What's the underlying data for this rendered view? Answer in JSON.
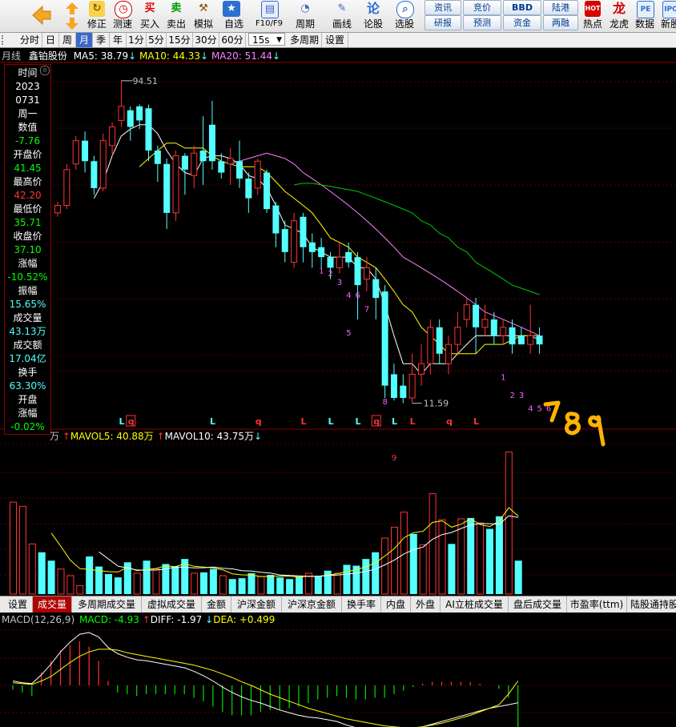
{
  "toolbar": {
    "buttons": [
      {
        "label": "",
        "icon": "arrow-left-icon"
      },
      {
        "label": "修正",
        "icon": "up-down-arrow-icon"
      },
      {
        "label": "测速",
        "icon": "speed-icon"
      },
      {
        "label": "买入",
        "icon": "buy-icon",
        "glyph": "买"
      },
      {
        "label": "卖出",
        "icon": "sell-icon",
        "glyph": "卖"
      },
      {
        "label": "模拟",
        "icon": "hammer-icon"
      },
      {
        "label": "自选",
        "icon": "star-icon"
      },
      {
        "label": "F10/F9",
        "icon": "f10-icon"
      },
      {
        "label": "周期",
        "icon": "clock-icon"
      },
      {
        "label": "画线",
        "icon": "pencil-icon"
      },
      {
        "label": "论股",
        "icon": "discuss-icon",
        "glyph": "论"
      },
      {
        "label": "选股",
        "icon": "stock-pick-icon"
      }
    ],
    "small_buttons": [
      "资讯",
      "竞价",
      "BBD",
      "陆港",
      "研报",
      "预测",
      "资金",
      "两融"
    ],
    "right_buttons": [
      {
        "label": "热点",
        "icon": "hot-icon",
        "glyph": "HOT"
      },
      {
        "label": "龙虎",
        "icon": "dragon-icon"
      },
      {
        "label": "数据",
        "icon": "pe-icon",
        "glyph": "PE"
      },
      {
        "label": "新股",
        "icon": "new-stock-icon"
      }
    ]
  },
  "period_bar": {
    "items": [
      "分时",
      "日",
      "周",
      "月",
      "季",
      "年",
      "1分",
      "5分",
      "15分",
      "30分",
      "60分",
      "15s",
      "多周期",
      "设置"
    ],
    "active": "月"
  },
  "chart_header": {
    "period": "月线",
    "stock": "鑫铂股份",
    "ma5": "MA5: 38.79",
    "ma10": "MA10: 44.33",
    "ma20": "MA20: 51.44"
  },
  "info_panel": {
    "rows": [
      {
        "text": "时间",
        "color": "#ffffff"
      },
      {
        "text": "2023",
        "color": "#ffffff"
      },
      {
        "text": "0731",
        "color": "#ffffff"
      },
      {
        "text": "周一",
        "color": "#ffffff"
      },
      {
        "text": "数值",
        "color": "#ffffff"
      },
      {
        "text": "-7.76",
        "color": "#00ff00"
      },
      {
        "text": "开盘价",
        "color": "#ffffff"
      },
      {
        "text": "41.45",
        "color": "#00ff00"
      },
      {
        "text": "最高价",
        "color": "#ffffff"
      },
      {
        "text": "42.20",
        "color": "#ff3232"
      },
      {
        "text": "最低价",
        "color": "#ffffff"
      },
      {
        "text": "35.71",
        "color": "#00ff00"
      },
      {
        "text": "收盘价",
        "color": "#ffffff"
      },
      {
        "text": "37.10",
        "color": "#00ff00"
      },
      {
        "text": "涨幅",
        "color": "#ffffff"
      },
      {
        "text": "-10.52%",
        "color": "#00ff00"
      },
      {
        "text": "振幅",
        "color": "#ffffff"
      },
      {
        "text": "15.65%",
        "color": "#54ffff"
      },
      {
        "text": "成交量",
        "color": "#ffffff"
      },
      {
        "text": "43.13万",
        "color": "#54ffff"
      },
      {
        "text": "成交额",
        "color": "#ffffff"
      },
      {
        "text": "17.04亿",
        "color": "#54ffff"
      },
      {
        "text": "换手",
        "color": "#ffffff"
      },
      {
        "text": "63.30%",
        "color": "#54ffff"
      },
      {
        "text": "开盘",
        "color": "#ffffff"
      },
      {
        "text": "涨幅",
        "color": "#ffffff"
      },
      {
        "text": "-0.02%",
        "color": "#00ff00"
      }
    ]
  },
  "volume_header": {
    "unit": "万",
    "mavol5": "MAVOL5: 40.88万",
    "mavol10": "MAVOL10: 43.75万"
  },
  "bottom_tabs": {
    "items": [
      "设置",
      "成交量",
      "多周期成交量",
      "虚拟成交量",
      "金额",
      "沪深金额",
      "沪深京金额",
      "换手率",
      "内盘",
      "外盘",
      "AI立桩成交量",
      "盘后成交量",
      "市盈率(ttm)",
      "陆股通持股"
    ],
    "active": "成交量"
  },
  "macd_header": {
    "name": "MACD(12,26,9)",
    "macd": "MACD: -4.93",
    "diff": "DIFF: -1.97",
    "dea": "DEA: +0.499"
  },
  "chart_data": {
    "type": "candlestick",
    "price_range": [
      10,
      100
    ],
    "high_label": "94.51",
    "low_label": "11.59",
    "candles": [
      {
        "o": 40,
        "c": 42,
        "h": 43,
        "l": 39
      },
      {
        "o": 42,
        "c": 53,
        "h": 55,
        "l": 41
      },
      {
        "o": 55,
        "c": 64,
        "h": 66,
        "l": 53
      },
      {
        "o": 64,
        "c": 56,
        "h": 68,
        "l": 52
      },
      {
        "o": 56,
        "c": 47,
        "h": 58,
        "l": 45
      },
      {
        "o": 47,
        "c": 64,
        "h": 67,
        "l": 46
      },
      {
        "o": 62,
        "c": 70,
        "h": 72,
        "l": 58
      },
      {
        "o": 73,
        "c": 80,
        "h": 94.51,
        "l": 70
      },
      {
        "o": 78,
        "c": 70,
        "h": 80,
        "l": 64
      },
      {
        "o": 80,
        "c": 73,
        "h": 81,
        "l": 69
      },
      {
        "o": 79,
        "c": 60,
        "h": 81,
        "l": 56
      },
      {
        "o": 60,
        "c": 55,
        "h": 62,
        "l": 49
      },
      {
        "o": 55,
        "c": 40,
        "h": 57,
        "l": 36
      },
      {
        "o": 40,
        "c": 58,
        "h": 60,
        "l": 38
      },
      {
        "o": 58,
        "c": 53,
        "h": 59,
        "l": 45
      },
      {
        "o": 51,
        "c": 59,
        "h": 62,
        "l": 47
      },
      {
        "o": 60,
        "c": 56,
        "h": 75,
        "l": 48
      },
      {
        "o": 71,
        "c": 56,
        "h": 83,
        "l": 53
      },
      {
        "o": 56,
        "c": 52,
        "h": 59,
        "l": 50
      },
      {
        "o": 55,
        "c": 57,
        "h": 61,
        "l": 48
      },
      {
        "o": 56,
        "c": 50,
        "h": 64,
        "l": 47
      },
      {
        "o": 50,
        "c": 44,
        "h": 52,
        "l": 40
      },
      {
        "o": 47,
        "c": 56,
        "h": 57,
        "l": 45
      },
      {
        "o": 52,
        "c": 41,
        "h": 53,
        "l": 40
      },
      {
        "o": 42,
        "c": 35,
        "h": 43,
        "l": 32
      },
      {
        "o": 36,
        "c": 31,
        "h": 38,
        "l": 29
      },
      {
        "o": 29,
        "c": 38,
        "h": 40,
        "l": 28
      },
      {
        "o": 39,
        "c": 32,
        "h": 40,
        "l": 29
      },
      {
        "o": 33,
        "c": 31,
        "h": 35,
        "l": 28
      },
      {
        "o": 32,
        "c": 30,
        "h": 34,
        "l": 28
      },
      {
        "o": 30,
        "c": 28,
        "h": 31,
        "l": 26
      },
      {
        "o": 28,
        "c": 30,
        "h": 33,
        "l": 27
      },
      {
        "o": 31,
        "c": 29,
        "h": 33,
        "l": 28
      },
      {
        "o": 30,
        "c": 25,
        "h": 31,
        "l": 20
      },
      {
        "o": 26,
        "c": 28,
        "h": 30,
        "l": 24
      },
      {
        "o": 26,
        "c": 23,
        "h": 28,
        "l": 20
      },
      {
        "o": 24,
        "c": 13,
        "h": 25,
        "l": 12
      },
      {
        "o": 14,
        "c": 12,
        "h": 15,
        "l": 11.8
      },
      {
        "o": 13,
        "c": 12,
        "h": 14,
        "l": 11.6
      },
      {
        "o": 12,
        "c": 14,
        "h": 16,
        "l": 11.59
      },
      {
        "o": 14,
        "c": 15,
        "h": 17,
        "l": 13
      },
      {
        "o": 15,
        "c": 19,
        "h": 20,
        "l": 14
      },
      {
        "o": 19,
        "c": 16,
        "h": 20,
        "l": 15
      },
      {
        "o": 15,
        "c": 17,
        "h": 18,
        "l": 14
      },
      {
        "o": 17,
        "c": 19,
        "h": 21,
        "l": 16
      },
      {
        "o": 20,
        "c": 22,
        "h": 23,
        "l": 19
      },
      {
        "o": 22,
        "c": 19,
        "h": 23,
        "l": 16
      },
      {
        "o": 19,
        "c": 20,
        "h": 22,
        "l": 18
      },
      {
        "o": 20,
        "c": 18,
        "h": 21,
        "l": 17
      },
      {
        "o": 18,
        "c": 19,
        "h": 20,
        "l": 17
      },
      {
        "o": 19,
        "c": 17,
        "h": 20,
        "l": 16
      },
      {
        "o": 18,
        "c": 17,
        "h": 19,
        "l": 17
      },
      {
        "o": 17,
        "c": 18,
        "h": 22,
        "l": 16
      },
      {
        "o": 18,
        "c": 17,
        "h": 19,
        "l": 16
      }
    ],
    "ma5": [
      null,
      null,
      null,
      null,
      44,
      49,
      58,
      66,
      69,
      71,
      71,
      67,
      60,
      55,
      52,
      51,
      57,
      58,
      58,
      57,
      55,
      51,
      50,
      47,
      42,
      37,
      36,
      35,
      32,
      31,
      30,
      30,
      30,
      28,
      28,
      26,
      22,
      18,
      15,
      15,
      14,
      15,
      15,
      15,
      16,
      17,
      18,
      18,
      18,
      18,
      18,
      18,
      18,
      17.5
    ],
    "ma10": [
      null,
      null,
      null,
      null,
      null,
      null,
      null,
      null,
      null,
      54,
      57,
      60,
      63,
      63,
      61,
      61,
      61,
      58,
      56,
      55,
      54,
      54,
      54,
      52,
      49,
      46,
      44,
      42,
      40,
      37,
      34,
      33,
      32,
      30,
      29,
      28,
      26,
      24,
      22,
      21,
      19,
      18,
      17,
      16,
      16,
      16,
      16,
      17,
      17,
      17,
      17.5,
      18,
      18,
      18
    ],
    "ma20": [
      null,
      null,
      null,
      null,
      null,
      null,
      null,
      null,
      null,
      null,
      null,
      null,
      null,
      null,
      null,
      null,
      null,
      null,
      null,
      55,
      56,
      57,
      58,
      59,
      58,
      57,
      55,
      52,
      50,
      48,
      46,
      44,
      42,
      40,
      38,
      36,
      34,
      32,
      30,
      29,
      28,
      27,
      26,
      25,
      24,
      23,
      22,
      21,
      20.5,
      20,
      19.5,
      19,
      18.5,
      18
    ],
    "ma60": [
      null,
      null,
      null,
      null,
      null,
      null,
      null,
      null,
      null,
      null,
      null,
      null,
      null,
      null,
      null,
      null,
      null,
      null,
      null,
      null,
      null,
      null,
      null,
      null,
      null,
      null,
      null,
      null,
      null,
      null,
      null,
      null,
      null,
      null,
      null,
      null,
      null,
      null,
      null,
      null,
      null,
      null,
      null,
      null,
      null,
      null,
      null,
      null,
      null,
      null,
      null,
      null,
      null,
      null
    ],
    "ma_green_start": 26,
    "ma_green": [
      48,
      48.5,
      48.5,
      48,
      47.5,
      47,
      46.5,
      46,
      45,
      44,
      43,
      42,
      41,
      40,
      38,
      37,
      35,
      34,
      32,
      31,
      29,
      28,
      27,
      26,
      25,
      24.5,
      24,
      23.5
    ],
    "labels_numbers": [
      {
        "i": 29,
        "t": "1",
        "p": 27
      },
      {
        "i": 30,
        "t": "2",
        "p": 26.5
      },
      {
        "i": 31,
        "t": "3",
        "p": 25
      },
      {
        "i": 32,
        "t": "4",
        "p": 23
      },
      {
        "i": 33,
        "t": "6",
        "p": 23
      },
      {
        "i": 34,
        "t": "7",
        "p": 21
      },
      {
        "i": 32,
        "t": "5",
        "p": 18
      },
      {
        "i": 36,
        "t": "8",
        "p": 11.5
      },
      {
        "i": 37,
        "t": "9",
        "p": 8
      },
      {
        "i": 49,
        "t": "1",
        "p": 13.5
      },
      {
        "i": 50,
        "t": "2",
        "p": 12
      },
      {
        "i": 51,
        "t": "3",
        "p": 12
      },
      {
        "i": 52,
        "t": "4",
        "p": 11
      },
      {
        "i": 53,
        "t": "5",
        "p": 11
      },
      {
        "i": 54,
        "t": "6",
        "p": 11
      }
    ],
    "bottom_markers": [
      {
        "i": 7,
        "t": "L",
        "c": "#54ffff"
      },
      {
        "i": 8,
        "t": "q",
        "c": "#ff3232",
        "box": true
      },
      {
        "i": 17,
        "t": "L",
        "c": "#54ffff"
      },
      {
        "i": 22,
        "t": "q",
        "c": "#ff3232"
      },
      {
        "i": 27,
        "t": "L",
        "c": "#ff3232"
      },
      {
        "i": 30,
        "t": "L",
        "c": "#54ffff"
      },
      {
        "i": 33,
        "t": "L",
        "c": "#54ffff"
      },
      {
        "i": 35,
        "t": "q",
        "c": "#ff3232",
        "box": true
      },
      {
        "i": 37,
        "t": "L",
        "c": "#54ffff"
      },
      {
        "i": 39,
        "t": "L",
        "c": "#ff3232"
      },
      {
        "i": 43,
        "t": "q",
        "c": "#ff3232"
      },
      {
        "i": 46,
        "t": "L",
        "c": "#ff3232"
      }
    ],
    "volume": [
      110,
      105,
      60,
      50,
      40,
      30,
      22,
      10,
      45,
      33,
      24,
      20,
      38,
      25,
      40,
      30,
      36,
      33,
      42,
      25,
      26,
      30,
      22,
      18,
      19,
      25,
      21,
      23,
      20,
      18,
      21,
      25,
      22,
      28,
      25,
      35,
      34,
      42,
      50,
      67,
      80,
      98,
      72,
      59,
      120,
      89,
      60,
      90,
      91,
      85,
      78,
      93,
      170,
      40
    ],
    "volume_max": 180,
    "macd_diff": [
      0.5,
      0.3,
      0.2,
      1.2,
      2.4,
      3.8,
      4.9,
      5.8,
      6.0,
      5.5,
      4.3,
      3.6,
      3.2,
      2.9,
      2.8,
      2.6,
      2.4,
      2.2,
      2.0,
      1.6,
      1.1,
      0.5,
      -0.2,
      -0.8,
      -1.3,
      -1.7,
      -2.0,
      -2.4,
      -2.8,
      -3.1,
      -3.4,
      -3.6,
      -3.7,
      -3.9,
      -4.1,
      -4.5,
      -4.8,
      -5.0,
      -5.1,
      -5.3,
      -5.2,
      -5.1,
      -4.9,
      -4.7,
      -4.4,
      -4.1,
      -3.8,
      -3.5,
      -3.2,
      -2.9,
      -2.6,
      -2.4,
      -2.2,
      -1.97
    ],
    "macd_dea": [
      0.3,
      0.2,
      0.1,
      0.5,
      1.0,
      1.8,
      2.6,
      3.3,
      3.8,
      4.1,
      4.1,
      4.0,
      3.7,
      3.5,
      3.3,
      3.1,
      2.9,
      2.7,
      2.5,
      2.3,
      2.0,
      1.7,
      1.3,
      0.9,
      0.4,
      0,
      -0.5,
      -1.0,
      -1.4,
      -1.8,
      -2.2,
      -2.6,
      -2.9,
      -3.2,
      -3.5,
      -3.8,
      -4.0,
      -4.2,
      -4.4,
      -4.6,
      -4.7,
      -4.8,
      -4.8,
      -4.7,
      -4.5,
      -4.3,
      -4.0,
      -3.7,
      -3.4,
      -3.0,
      -2.6,
      -2.2,
      -1.0,
      0.499
    ],
    "macd_bars": [
      -0.5,
      -0.8,
      -1.2,
      1.5,
      2.8,
      4.0,
      4.6,
      5.0,
      4.4,
      2.8,
      0.5,
      -0.8,
      -1.0,
      -1.2,
      -1.0,
      -1.0,
      -1.0,
      -1.0,
      -1.0,
      -1.4,
      -1.8,
      -2.4,
      -3.0,
      -3.4,
      -3.4,
      -3.4,
      -3.0,
      -2.8,
      -2.8,
      -2.6,
      -2.4,
      -2.0,
      -1.6,
      -1.4,
      -1.2,
      -1.4,
      -1.6,
      -1.6,
      -1.4,
      -1.4,
      -1.0,
      -0.6,
      -0.2,
      0.2,
      0.4,
      0.4,
      0.4,
      0.4,
      0.4,
      0.2,
      0.0,
      -0.4,
      -1.4,
      -4.93
    ]
  }
}
